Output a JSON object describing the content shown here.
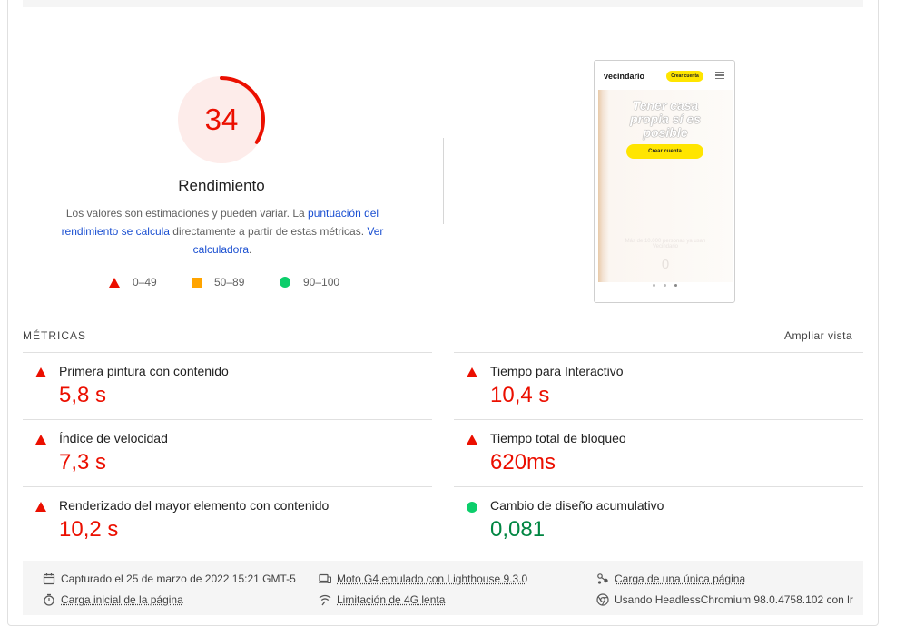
{
  "gauge": {
    "score": "34",
    "score_fraction": 0.34,
    "title": "Rendimiento",
    "color": "#eb0f00"
  },
  "description": {
    "text1": "Los valores son estimaciones y pueden variar. La ",
    "link1": "puntuación del rendimiento se calcula",
    "text2": " directamente a partir de estas métricas. ",
    "link2": "Ver calculadora",
    "text3": "."
  },
  "legend": [
    {
      "range": "0–49",
      "icon": "red-triangle-icon",
      "color": "#eb0f00"
    },
    {
      "range": "50–89",
      "icon": "orange-square-icon",
      "color": "#ffa400"
    },
    {
      "range": "90–100",
      "icon": "green-circle-icon",
      "color": "#0cce6b"
    }
  ],
  "thumbnail": {
    "logo": "vecindario",
    "header_button": "Crear cuenta",
    "headline": "Tener casa propia sí es posible",
    "cta": "Crear cuenta",
    "faint_text": "Más de 10.000 personas ya usan Vecindario",
    "faint_number": "0"
  },
  "metrics": {
    "header": "MÉTRICAS",
    "expand_label": "Ampliar vista",
    "items": [
      {
        "name": "Primera pintura con contenido",
        "value": "5,8 s",
        "status": "fail"
      },
      {
        "name": "Tiempo para Interactivo",
        "value": "10,4 s",
        "status": "fail"
      },
      {
        "name": "Índice de velocidad",
        "value": "7,3 s",
        "status": "fail"
      },
      {
        "name": "Tiempo total de bloqueo",
        "value": "620ms",
        "status": "fail"
      },
      {
        "name": "Renderizado del mayor elemento con contenido",
        "value": "10,2 s",
        "status": "fail"
      },
      {
        "name": "Cambio de diseño acumulativo",
        "value": "0,081",
        "status": "pass"
      }
    ]
  },
  "footer": {
    "captured": "Capturado el 25 de marzo de 2022 15:21 GMT-5",
    "device": "Moto G4 emulado con Lighthouse 9.3.0",
    "page_load": "Carga de una única página",
    "initial_load": "Carga inicial de la página",
    "throttling": "Limitación de 4G lenta",
    "browser": "Usando HeadlessChromium 98.0.4758.102 con lr"
  }
}
